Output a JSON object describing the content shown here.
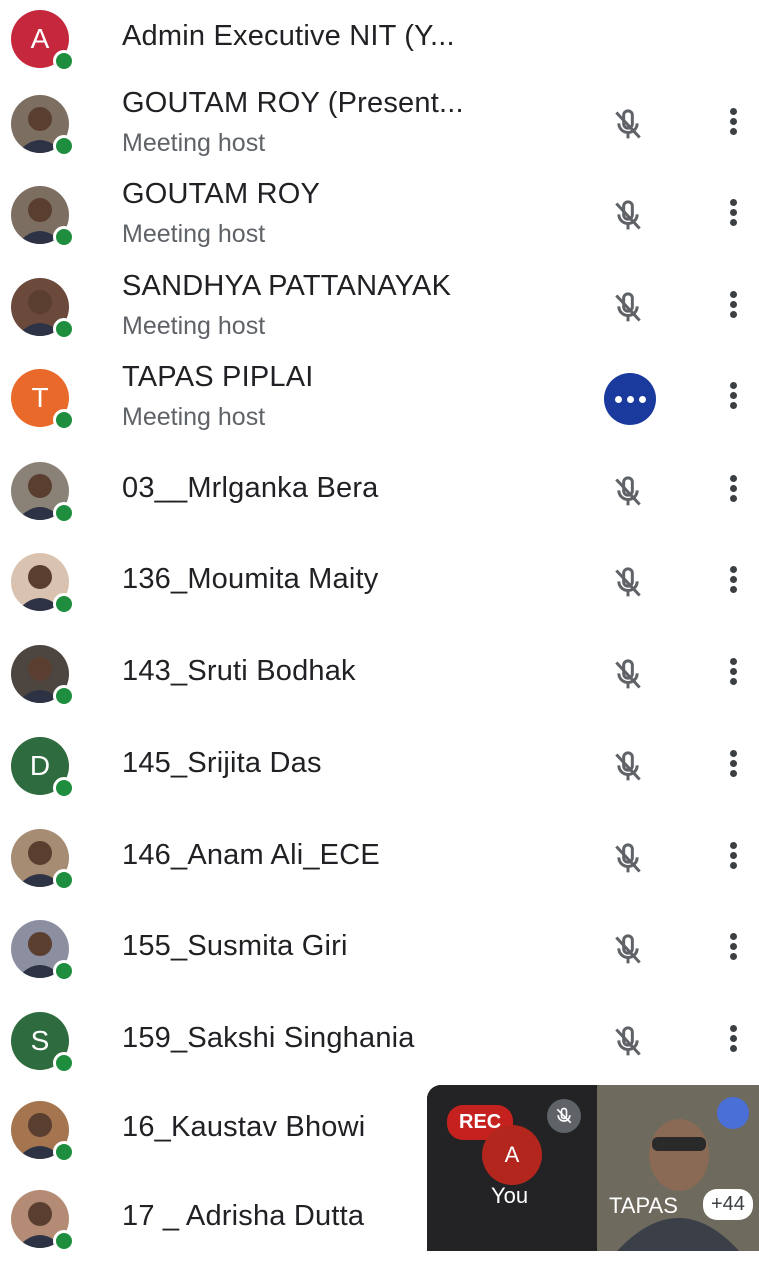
{
  "participants": [
    {
      "name": "Admin Executive NIT (Y...",
      "role": "",
      "avatar": "A",
      "avatar_color": "#c5283d",
      "mic": "none"
    },
    {
      "name": "GOUTAM ROY (Present...",
      "role": "Meeting host",
      "avatar": "",
      "avatar_color": "#7d6e62",
      "mic": "muted"
    },
    {
      "name": "GOUTAM ROY",
      "role": "Meeting host",
      "avatar": "",
      "avatar_color": "#7d6e62",
      "mic": "muted"
    },
    {
      "name": "SANDHYA PATTANAYAK",
      "role": "Meeting host",
      "avatar": "",
      "avatar_color": "#6b4a3c",
      "mic": "muted"
    },
    {
      "name": "TAPAS PIPLAI",
      "role": "Meeting host",
      "avatar": "T",
      "avatar_color": "#e8692a",
      "mic": "speaking"
    },
    {
      "name": "03__Mrlganka Bera",
      "role": "",
      "avatar": "",
      "avatar_color": "#8a8276",
      "mic": "muted"
    },
    {
      "name": "136_Moumita Maity",
      "role": "",
      "avatar": "",
      "avatar_color": "#d9c3b0",
      "mic": "muted"
    },
    {
      "name": "143_Sruti Bodhak",
      "role": "",
      "avatar": "",
      "avatar_color": "#4d4540",
      "mic": "muted"
    },
    {
      "name": "145_Srijita Das",
      "role": "",
      "avatar": "D",
      "avatar_color": "#2e6b3e",
      "mic": "muted"
    },
    {
      "name": "146_Anam Ali_ECE",
      "role": "",
      "avatar": "",
      "avatar_color": "#a68c72",
      "mic": "muted"
    },
    {
      "name": "155_Susmita Giri",
      "role": "",
      "avatar": "",
      "avatar_color": "#8c8fa0",
      "mic": "muted"
    },
    {
      "name": "159_Sakshi Singhania",
      "role": "",
      "avatar": "S",
      "avatar_color": "#2e6b3e",
      "mic": "muted"
    },
    {
      "name": "16_Kaustav Bhowi",
      "role": "",
      "avatar": "",
      "avatar_color": "#a5754f",
      "mic": "none"
    },
    {
      "name": "17 _ Adrisha Dutta",
      "role": "",
      "avatar": "",
      "avatar_color": "#b48c76",
      "mic": "none"
    }
  ],
  "self_view": {
    "rec_label": "REC",
    "avatar": "A",
    "you_label": "You",
    "other_label": "TAPAS",
    "extra_count": "+44"
  }
}
